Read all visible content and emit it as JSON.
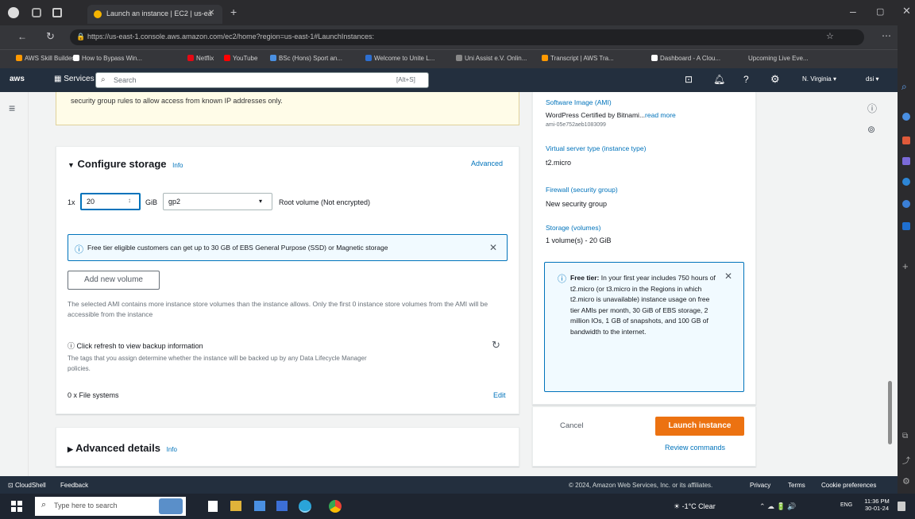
{
  "browser": {
    "tab_title": "Launch an instance | EC2 | us-ea",
    "url": "https://us-east-1.console.aws.amazon.com/ec2/home?region=us-east-1#LaunchInstances:",
    "bookmarks": [
      "AWS Skill Builder",
      "How to Bypass Win...",
      "Netflix",
      "YouTube",
      "BSc (Hons) Sport an...",
      "Welcome to Unite L...",
      "Uni Assist e.V. Onlin...",
      "Transcript | AWS Tra...",
      "Dashboard - A Clou...",
      "Upcoming Live Eve..."
    ]
  },
  "awsnav": {
    "services": "Services",
    "search_placeholder": "Search",
    "search_shortcut": "[Alt+S]",
    "region": "N. Virginia",
    "account": "dsi"
  },
  "warning": {
    "text": "security group rules to allow access from known IP addresses only."
  },
  "storage": {
    "title": "Configure storage",
    "info": "Info",
    "advanced": "Advanced",
    "count": "1x",
    "size": "20",
    "unit": "GiB",
    "type": "gp2",
    "root_note": "Root volume  (Not encrypted)",
    "banner": "Free tier eligible customers can get up to 30 GB of EBS General Purpose (SSD) or Magnetic storage",
    "add_volume": "Add new volume",
    "ami_note": "The selected AMI contains more instance store volumes than the instance allows. Only the first 0 instance store volumes from the AMI will be accessible from the instance",
    "backup_title": "Click refresh to view backup information",
    "backup_note": "The tags that you assign determine whether the instance will be backed up by any Data Lifecycle Manager policies.",
    "filesystems": "0 x File systems",
    "edit": "Edit"
  },
  "advanced_details": {
    "title": "Advanced details",
    "info": "Info"
  },
  "summary": {
    "software_image_label": "Software Image (AMI)",
    "software_image_value": "WordPress Certified by Bitnami...",
    "read_more": "read more",
    "ami_id": "ami-05e752aeb1083099",
    "instance_type_label": "Virtual server type (instance type)",
    "instance_type_value": "t2.micro",
    "firewall_label": "Firewall (security group)",
    "firewall_value": "New security group",
    "storage_label": "Storage (volumes)",
    "storage_value": "1 volume(s) - 20 GiB",
    "free_tier_bold": "Free tier:",
    "free_tier_text": "In your first year includes 750 hours of t2.micro (or t3.micro in the Regions in which t2.micro is unavailable) instance usage on free tier AMIs per month, 30 GiB of EBS storage, 2 million IOs, 1 GB of snapshots, and 100 GB of bandwidth to the internet.",
    "cancel": "Cancel",
    "launch": "Launch instance",
    "review": "Review commands"
  },
  "footer": {
    "cloudshell": "CloudShell",
    "feedback": "Feedback",
    "copyright": "© 2024, Amazon Web Services, Inc. or its affiliates.",
    "privacy": "Privacy",
    "terms": "Terms",
    "cookies": "Cookie preferences"
  },
  "taskbar": {
    "search_placeholder": "Type here to search",
    "weather": "-1°C  Clear",
    "time": "11:36 PM",
    "date": "30-01-24",
    "lang": "ENG"
  },
  "colors": {
    "aws_nav": "#232f3e",
    "primary": "#ec7211",
    "link": "#0073bb"
  }
}
